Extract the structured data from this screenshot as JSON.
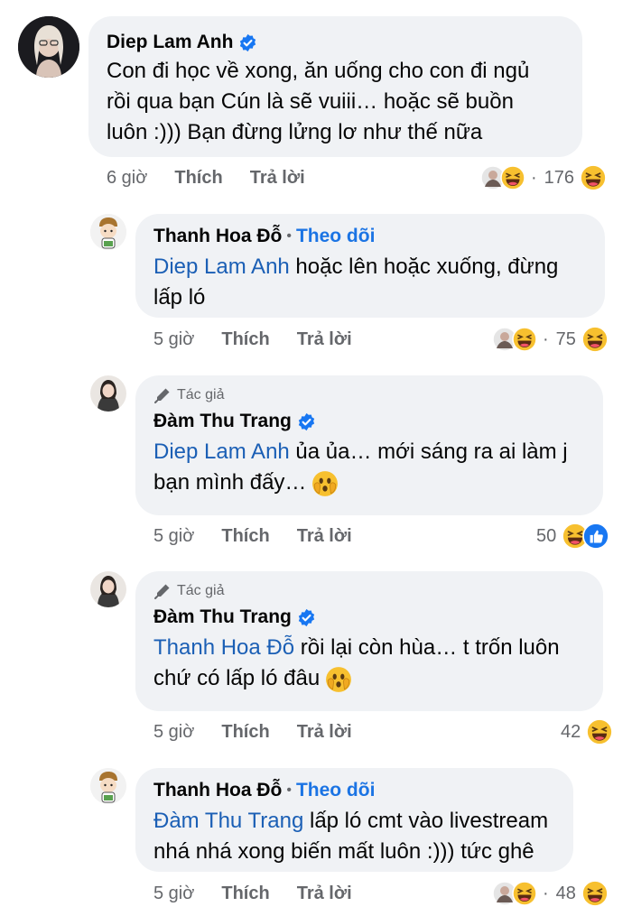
{
  "comments": [
    {
      "author": "Diep Lam Anh",
      "verified": true,
      "text": "Con đi học về xong, ăn uống cho con đi ngủ rồi qua bạn Cún là sẽ vuiii… hoặc sẽ buồn luôn :))) Bạn đừng lửng lơ như thế nữa",
      "lines": [
        "Con đi học về xong, ăn uống cho con đi ngủ",
        "rồi qua bạn Cún là sẽ vuiii… hoặc sẽ buồn",
        "luôn :))) Bạn đừng lửng lơ như thế nữa"
      ],
      "time": "6 giờ",
      "like": "Thích",
      "reply": "Trả lời",
      "reaction_count": "176",
      "reactions": [
        "avatar",
        "haha"
      ]
    },
    {
      "author": "Thanh Hoa Đỗ",
      "follow": "Theo dõi",
      "mention": "Diep Lam Anh",
      "line1_rest": " hoặc lên hoặc xuống, đừng",
      "line2": "lấp ló",
      "time": "5 giờ",
      "like": "Thích",
      "reply": "Trả lời",
      "reaction_count": "75",
      "reactions": [
        "avatar",
        "haha"
      ]
    },
    {
      "author_badge": "Tác giả",
      "author": "Đàm Thu Trang",
      "verified": true,
      "mention": "Diep Lam Anh",
      "line1_rest": " ủa ủa… mới sáng ra ai làm j",
      "line2": "bạn mình đấy…",
      "time": "5 giờ",
      "like": "Thích",
      "reply": "Trả lời",
      "reaction_count": "50",
      "reactions": [
        "haha",
        "like"
      ]
    },
    {
      "author_badge": "Tác giả",
      "author": "Đàm Thu Trang",
      "verified": true,
      "mention": "Thanh Hoa Đỗ",
      "line1_rest": " rồi lại còn hùa… t trốn luôn",
      "line2": "chứ có lấp ló đâu",
      "time": "5 giờ",
      "like": "Thích",
      "reply": "Trả lời",
      "reaction_count": "42",
      "reactions": [
        "haha"
      ]
    },
    {
      "author": "Thanh Hoa Đỗ",
      "follow": "Theo dõi",
      "mention": "Đàm Thu Trang",
      "line1_rest": " lấp ló cmt vào livestream",
      "line2": "nhá nhá xong biến mất luôn :))) tức ghê",
      "time": "5 giờ",
      "like": "Thích",
      "reply": "Trả lời",
      "reaction_count": "48",
      "reactions": [
        "avatar",
        "haha"
      ]
    }
  ],
  "colors": {
    "bubble": "#f0f2f5",
    "link": "#1b5fb5",
    "follow": "#1b74e4",
    "meta": "#65676b",
    "verified": "#1877f2"
  },
  "icons": {
    "verified": "verified-badge-icon",
    "author_badge": "pencil-icon",
    "haha": "haha-reaction-icon",
    "like": "like-reaction-icon"
  }
}
